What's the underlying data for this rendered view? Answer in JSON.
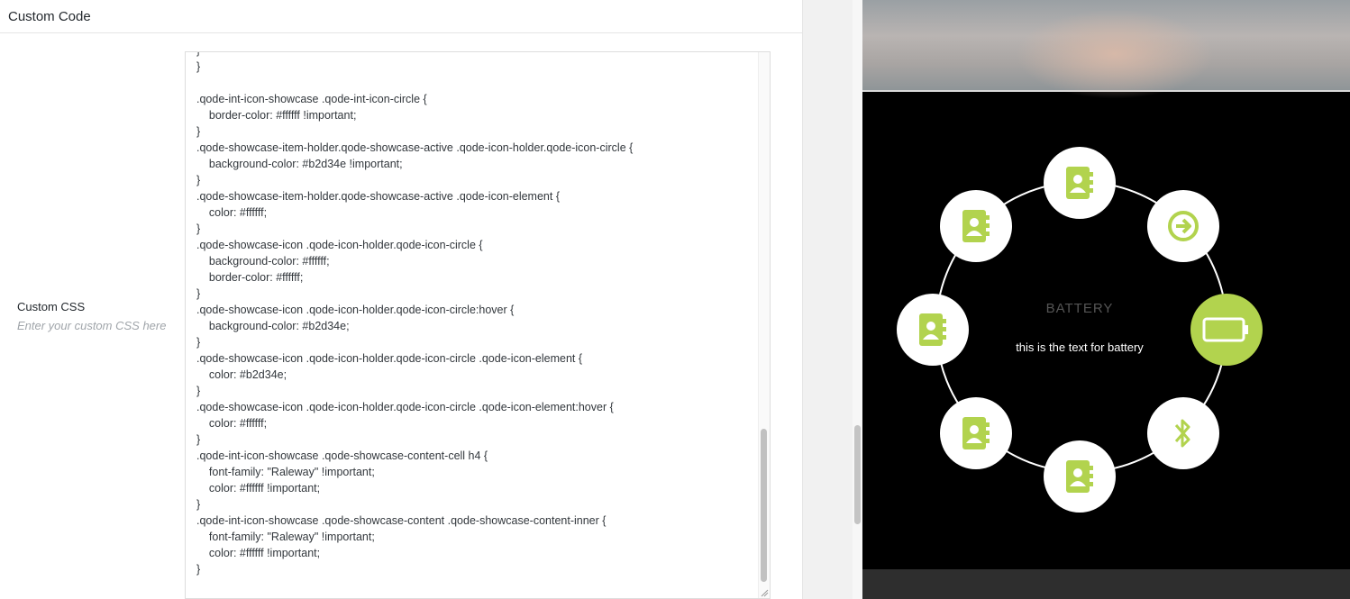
{
  "panel": {
    "title": "Custom Code",
    "field_title": "Custom CSS",
    "field_desc": "Enter your custom CSS here"
  },
  "css_code": "}\n}\n\n.qode-int-icon-showcase .qode-int-icon-circle {\n    border-color: #ffffff !important;\n}\n.qode-showcase-item-holder.qode-showcase-active .qode-icon-holder.qode-icon-circle {\n    background-color: #b2d34e !important;\n}\n.qode-showcase-item-holder.qode-showcase-active .qode-icon-element {\n    color: #ffffff;\n}\n.qode-showcase-icon .qode-icon-holder.qode-icon-circle {\n    background-color: #ffffff;\n    border-color: #ffffff;\n}\n.qode-showcase-icon .qode-icon-holder.qode-icon-circle:hover {\n    background-color: #b2d34e;\n}\n.qode-showcase-icon .qode-icon-holder.qode-icon-circle .qode-icon-element {\n    color: #b2d34e;\n}\n.qode-showcase-icon .qode-icon-holder.qode-icon-circle .qode-icon-element:hover {\n    color: #ffffff;\n}\n.qode-int-icon-showcase .qode-showcase-content-cell h4 {\n    font-family: \"Raleway\" !important;\n    color: #ffffff !important;\n}\n.qode-int-icon-showcase .qode-showcase-content .qode-showcase-content-inner {\n    font-family: \"Raleway\" !important;\n    color: #ffffff !important;\n}",
  "preview": {
    "title": "BATTERY",
    "text": "this is the text for battery",
    "accent": "#b2d34e",
    "icons": [
      {
        "name": "contact-book-icon",
        "active": false
      },
      {
        "name": "arrow-circle-icon",
        "active": false
      },
      {
        "name": "battery-icon",
        "active": true
      },
      {
        "name": "bluetooth-icon",
        "active": false
      },
      {
        "name": "contact-book-icon",
        "active": false
      },
      {
        "name": "contact-book-icon",
        "active": false
      },
      {
        "name": "contact-book-icon",
        "active": false
      },
      {
        "name": "contact-book-icon",
        "active": false
      }
    ]
  }
}
